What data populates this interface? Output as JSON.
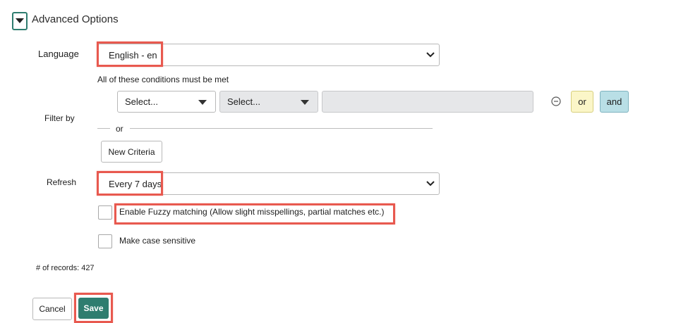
{
  "section": {
    "title": "Advanced Options",
    "toggle_icon": "caret-down-icon"
  },
  "language": {
    "label": "Language",
    "value": "English - en"
  },
  "conditions": {
    "heading": "All of these conditions must be met",
    "filter_label": "Filter by",
    "field_select": "Select...",
    "operator_select": "Select...",
    "value": "",
    "remove_icon": "minus-circle-icon",
    "or_button": "or",
    "and_button": "and",
    "divider_text": "or",
    "new_criteria_button": "New Criteria"
  },
  "refresh": {
    "label": "Refresh",
    "value": "Every 7 days"
  },
  "options": {
    "fuzzy_label": "Enable Fuzzy matching (Allow slight misspellings, partial matches etc.)",
    "fuzzy_checked": false,
    "case_label": "Make case sensitive",
    "case_checked": false
  },
  "records": {
    "text": "# of records: 427"
  },
  "footer": {
    "cancel_label": "Cancel",
    "save_label": "Save"
  },
  "colors": {
    "highlight": "#e8594f",
    "save_bg": "#2e7d6f",
    "or_bg": "#fbf6c8",
    "and_bg": "#b9dfe6",
    "toggle_border": "#2e7d6f"
  }
}
